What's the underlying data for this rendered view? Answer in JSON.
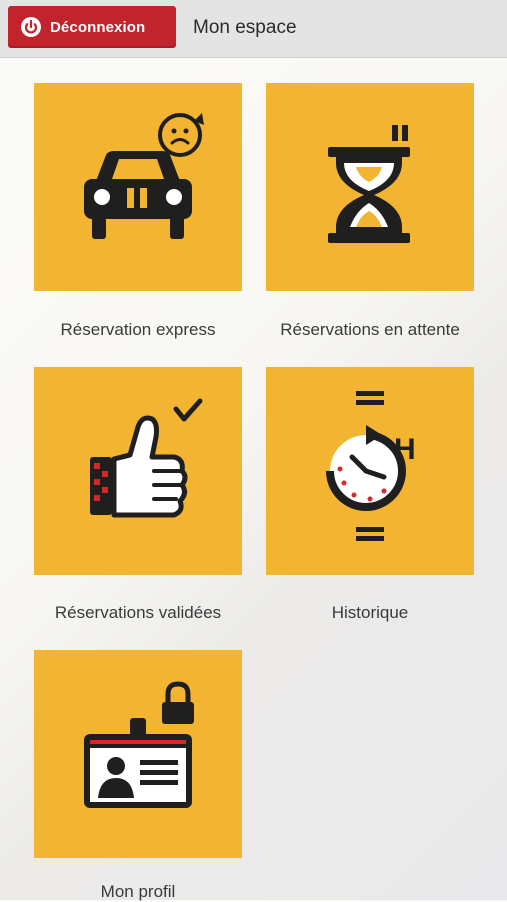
{
  "header": {
    "logout_label": "Déconnexion",
    "title": "Mon espace"
  },
  "tiles": [
    {
      "label": "Réservation express",
      "icon": "car-express-icon"
    },
    {
      "label": "Réservations en attente",
      "icon": "hourglass-icon"
    },
    {
      "label": "Réservations validées",
      "icon": "thumbs-up-check-icon"
    },
    {
      "label": "Historique",
      "icon": "clock-history-icon"
    },
    {
      "label": "Mon profil",
      "icon": "id-badge-lock-icon"
    }
  ],
  "colors": {
    "tile": "#f2b431",
    "logout": "#c2242e",
    "icon_dark": "#1f1f1f",
    "accent_red": "#d8262b"
  }
}
